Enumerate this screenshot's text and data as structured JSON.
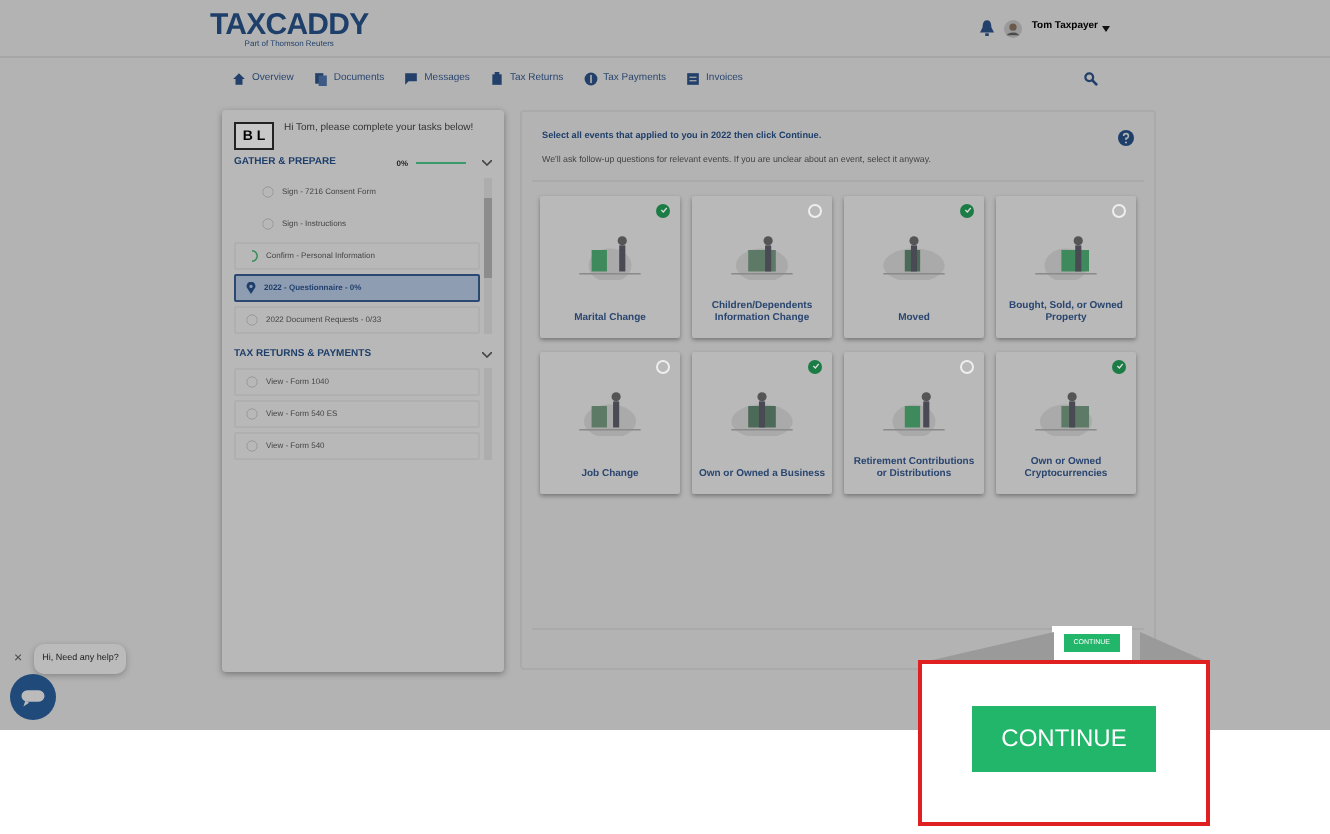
{
  "header": {
    "logo": "TAXCADDY",
    "logo_subtitle": "Part of Thomson Reuters",
    "user_name": "Tom Taxpayer"
  },
  "nav": [
    {
      "label": "Overview"
    },
    {
      "label": "Documents"
    },
    {
      "label": "Messages"
    },
    {
      "label": "Tax Returns"
    },
    {
      "label": "Tax Payments"
    },
    {
      "label": "Invoices"
    }
  ],
  "sidebar": {
    "badge": "B L",
    "greeting": "Hi Tom, please complete your tasks below!",
    "sections": [
      {
        "title": "GATHER & PREPARE",
        "progress": "0%",
        "expanded": true,
        "items": [
          {
            "label": "Sign - 7216 Consent Form",
            "kind": "subtask",
            "selected": false
          },
          {
            "label": "Sign - Instructions",
            "kind": "subtask",
            "selected": false
          },
          {
            "label": "Confirm - Personal Information",
            "kind": "in_progress",
            "selected": false
          },
          {
            "label": "2022 - Questionnaire - 0%",
            "kind": "current",
            "selected": true
          },
          {
            "label": "2022 Document Requests - 0/33",
            "kind": "task",
            "selected": false
          }
        ]
      },
      {
        "title": "TAX RETURNS & PAYMENTS",
        "expanded": true,
        "items": [
          {
            "label": "View - Form 1040",
            "kind": "task",
            "selected": false
          },
          {
            "label": "View - Form 540 ES",
            "kind": "task",
            "selected": false
          },
          {
            "label": "View - Form 540",
            "kind": "task",
            "selected": false
          }
        ]
      }
    ]
  },
  "main": {
    "instruction": "Select all events that applied to you in 2022 then click Continue.",
    "note": "We'll ask follow-up questions for relevant events. If you are unclear about an event, select it anyway.",
    "events": [
      {
        "label": "Marital Change",
        "selected": true
      },
      {
        "label": "Children/Dependents Information Change",
        "selected": false
      },
      {
        "label": "Moved",
        "selected": true
      },
      {
        "label": "Bought, Sold, or Owned Property",
        "selected": false
      },
      {
        "label": "Job Change",
        "selected": false
      },
      {
        "label": "Own or Owned a Business",
        "selected": true
      },
      {
        "label": "Retirement Contributions or Distributions",
        "selected": false
      },
      {
        "label": "Own or Owned Cryptocurrencies",
        "selected": true
      }
    ],
    "continue_small": "CONTINUE"
  },
  "chat": {
    "close": "×",
    "bubble": "Hi, Need any help?"
  },
  "callout": {
    "continue": "CONTINUE"
  }
}
